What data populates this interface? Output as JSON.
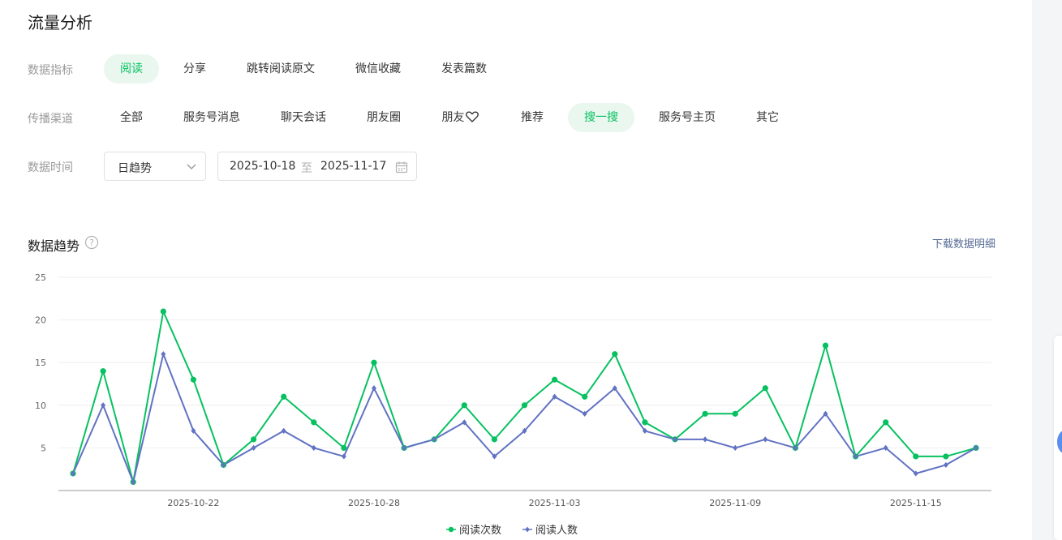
{
  "title": "流量分析",
  "metric": {
    "label": "数据指标",
    "options": [
      "阅读",
      "分享",
      "跳转阅读原文",
      "微信收藏",
      "发表篇数"
    ],
    "selected": "阅读"
  },
  "channel": {
    "label": "传播渠道",
    "options": [
      "全部",
      "服务号消息",
      "聊天会话",
      "朋友圈",
      "朋友",
      "推荐",
      "搜一搜",
      "服务号主页",
      "其它"
    ],
    "selected": "搜一搜",
    "friend_icon": "heart-icon"
  },
  "time": {
    "label": "数据时间",
    "granularity": "日趋势",
    "start": "2025-10-18",
    "separator": "至",
    "end": "2025-11-17"
  },
  "trend": {
    "title": "数据趋势",
    "download_label": "下载数据明细"
  },
  "colors": {
    "accent": "#07c160",
    "series_reads": "#07c160",
    "series_readers": "#6272c3",
    "link": "#576b95"
  },
  "chart_data": {
    "type": "line",
    "x_start": "2025-10-18",
    "x_end": "2025-11-17",
    "x_ticks": [
      "2025-10-22",
      "2025-10-28",
      "2025-11-03",
      "2025-11-09",
      "2025-11-15"
    ],
    "y_ticks": [
      5,
      10,
      15,
      20,
      25
    ],
    "ylim": [
      0,
      25
    ],
    "grid": true,
    "legend": "bottom-center",
    "series": [
      {
        "name": "阅读次数",
        "values": [
          2,
          14,
          1,
          21,
          13,
          3,
          6,
          11,
          8,
          5,
          15,
          5,
          6,
          10,
          6,
          10,
          13,
          11,
          16,
          8,
          6,
          9,
          9,
          12,
          5,
          17,
          4,
          8,
          4,
          4,
          5
        ]
      },
      {
        "name": "阅读人数",
        "values": [
          2,
          10,
          1,
          16,
          7,
          3,
          5,
          7,
          5,
          4,
          12,
          5,
          6,
          8,
          4,
          7,
          11,
          9,
          12,
          7,
          6,
          6,
          5,
          6,
          5,
          9,
          4,
          5,
          2,
          3,
          5
        ]
      }
    ]
  }
}
